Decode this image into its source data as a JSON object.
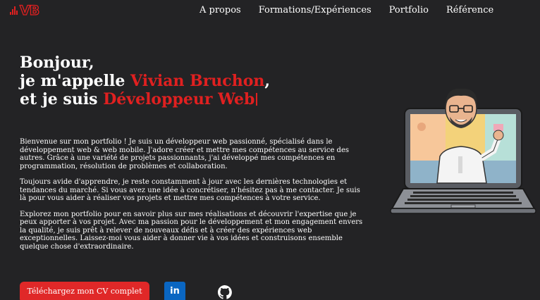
{
  "header": {
    "logo_text": "VB",
    "nav": [
      {
        "label": "A propos"
      },
      {
        "label": "Formations/Expériences"
      },
      {
        "label": "Portfolio"
      },
      {
        "label": "Référence"
      }
    ]
  },
  "hero": {
    "line1": "Bonjour,",
    "line2_prefix": "je m'appelle ",
    "name": "Vivian Bruchon",
    "line2_suffix": ",",
    "line3_prefix": "et je suis ",
    "role": "Développeur Web"
  },
  "intro": {
    "paragraphs": [
      "Bienvenue sur mon portfolio ! Je suis un développeur web passionné, spécialisé dans le développement web & web mobile. J'adore créer et mettre mes compétences au service des autres. Grâce à une variété de projets passionnants, j'ai développé mes compétences en programmation, résolution de problèmes et collaboration.",
      "Toujours avide d'apprendre, je reste constamment à jour avec les dernières technologies et tendances du marché. Si vous avez une idée à concrétiser, n'hésitez pas à me contacter. Je suis là pour vous aider à réaliser vos projets et mettre mes compétences à votre service.",
      "Explorez mon portfolio pour en savoir plus sur mes réalisations et découvrir l'expertise que je peux apporter à vos projet. Avec ma passion pour le développement et mon engagement envers la qualité, je suis prêt à relever de nouveaux défis et à créer des expériences web exceptionnelles. Laissez-moi vous aider à donner vie à vos idées et construisons ensemble quelque chose d'extraordinaire."
    ]
  },
  "actions": {
    "cv_label": "Téléchargez mon CV complet",
    "linkedin_label": "in"
  },
  "colors": {
    "background": "#232325",
    "accent": "#e02020",
    "linkedin": "#0a66c2"
  },
  "icons": [
    "logo-bars-icon",
    "linkedin-icon",
    "github-icon"
  ]
}
